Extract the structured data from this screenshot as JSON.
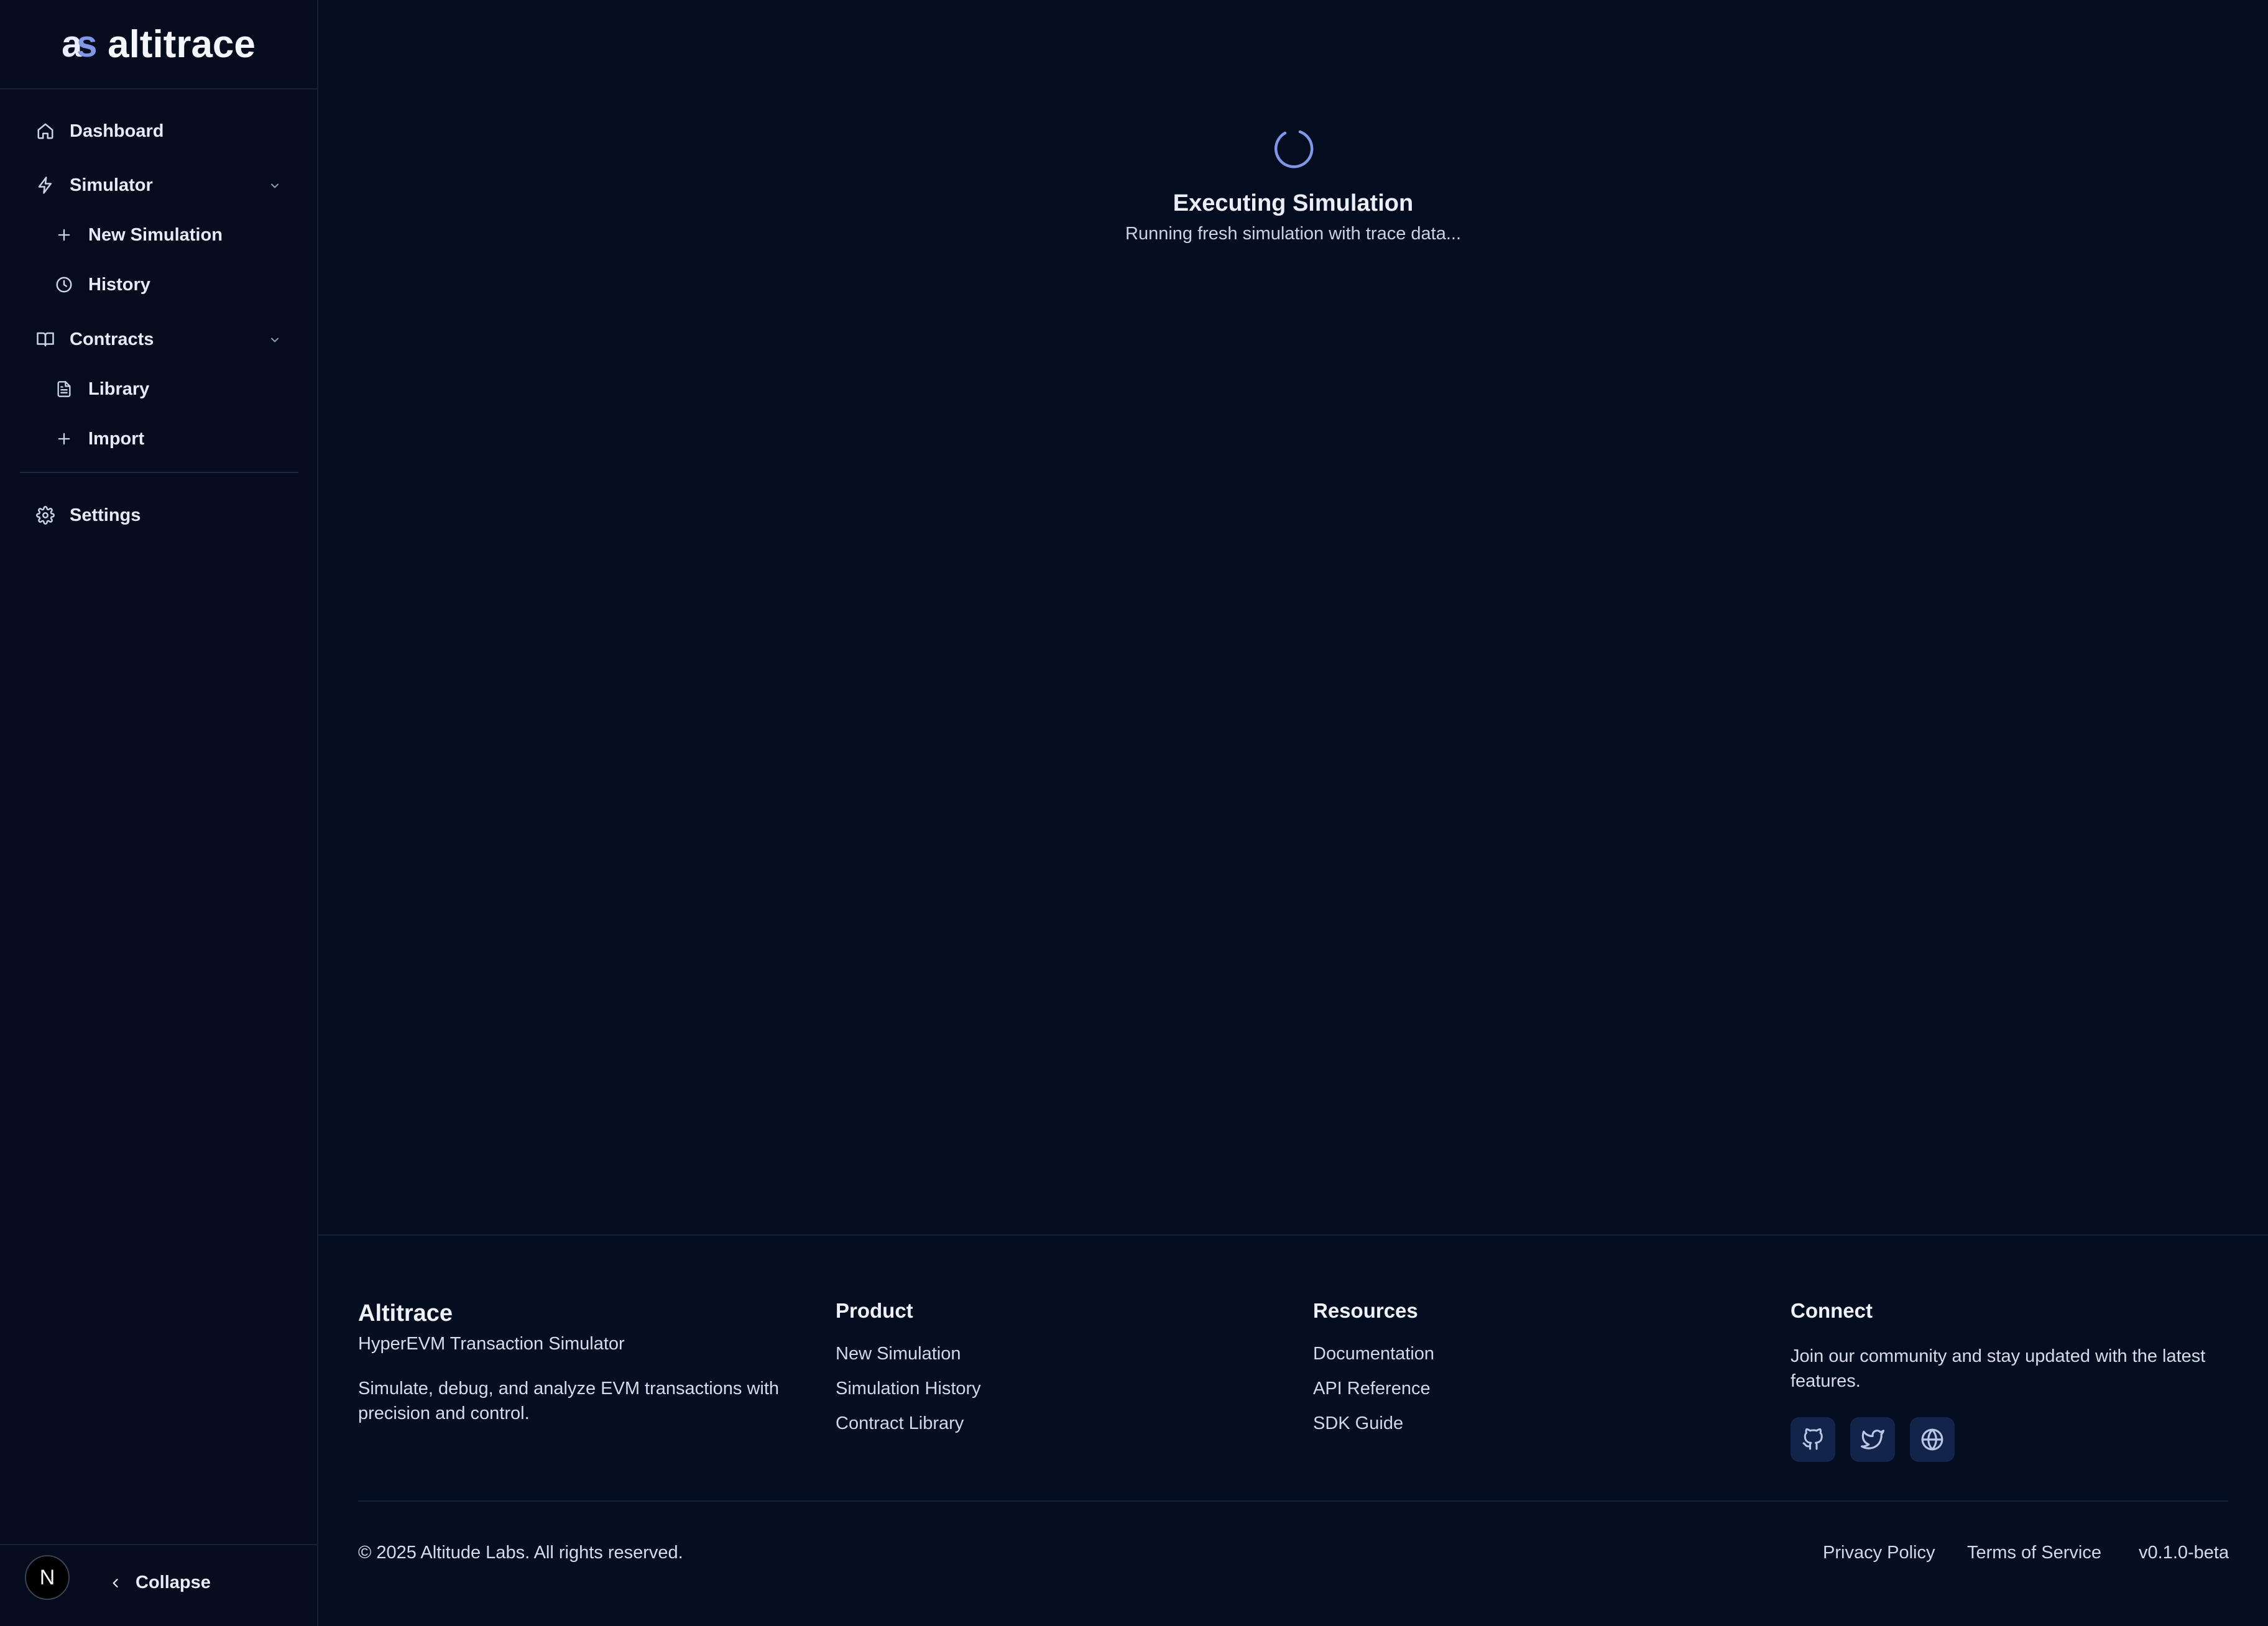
{
  "brand": {
    "mark_a": "a",
    "mark_s": "s",
    "name": "altitrace"
  },
  "sidebar": {
    "dashboard": "Dashboard",
    "simulator": "Simulator",
    "new_simulation": "New Simulation",
    "history": "History",
    "contracts": "Contracts",
    "library": "Library",
    "import": "Import",
    "settings": "Settings",
    "avatar_initial": "N",
    "collapse": "Collapse"
  },
  "main": {
    "loading_title": "Executing Simulation",
    "loading_subtitle": "Running fresh simulation with trace data..."
  },
  "footer": {
    "brand": "Altitrace",
    "tagline": "HyperEVM Transaction Simulator",
    "description": "Simulate, debug, and analyze EVM transactions with precision and control.",
    "product": {
      "heading": "Product",
      "links": [
        "New Simulation",
        "Simulation History",
        "Contract Library"
      ]
    },
    "resources": {
      "heading": "Resources",
      "links": [
        "Documentation",
        "API Reference",
        "SDK Guide"
      ]
    },
    "connect": {
      "heading": "Connect",
      "text": "Join our community and stay updated with the latest features.",
      "social": [
        "github-icon",
        "twitter-icon",
        "globe-icon"
      ]
    },
    "copyright": "© 2025 Altitude Labs. All rights reserved.",
    "privacy": "Privacy Policy",
    "terms": "Terms of Service",
    "version": "v0.1.0-beta"
  },
  "colors": {
    "background": "#040c1f",
    "accent": "#7f97e6",
    "social_bg": "#13244a"
  }
}
